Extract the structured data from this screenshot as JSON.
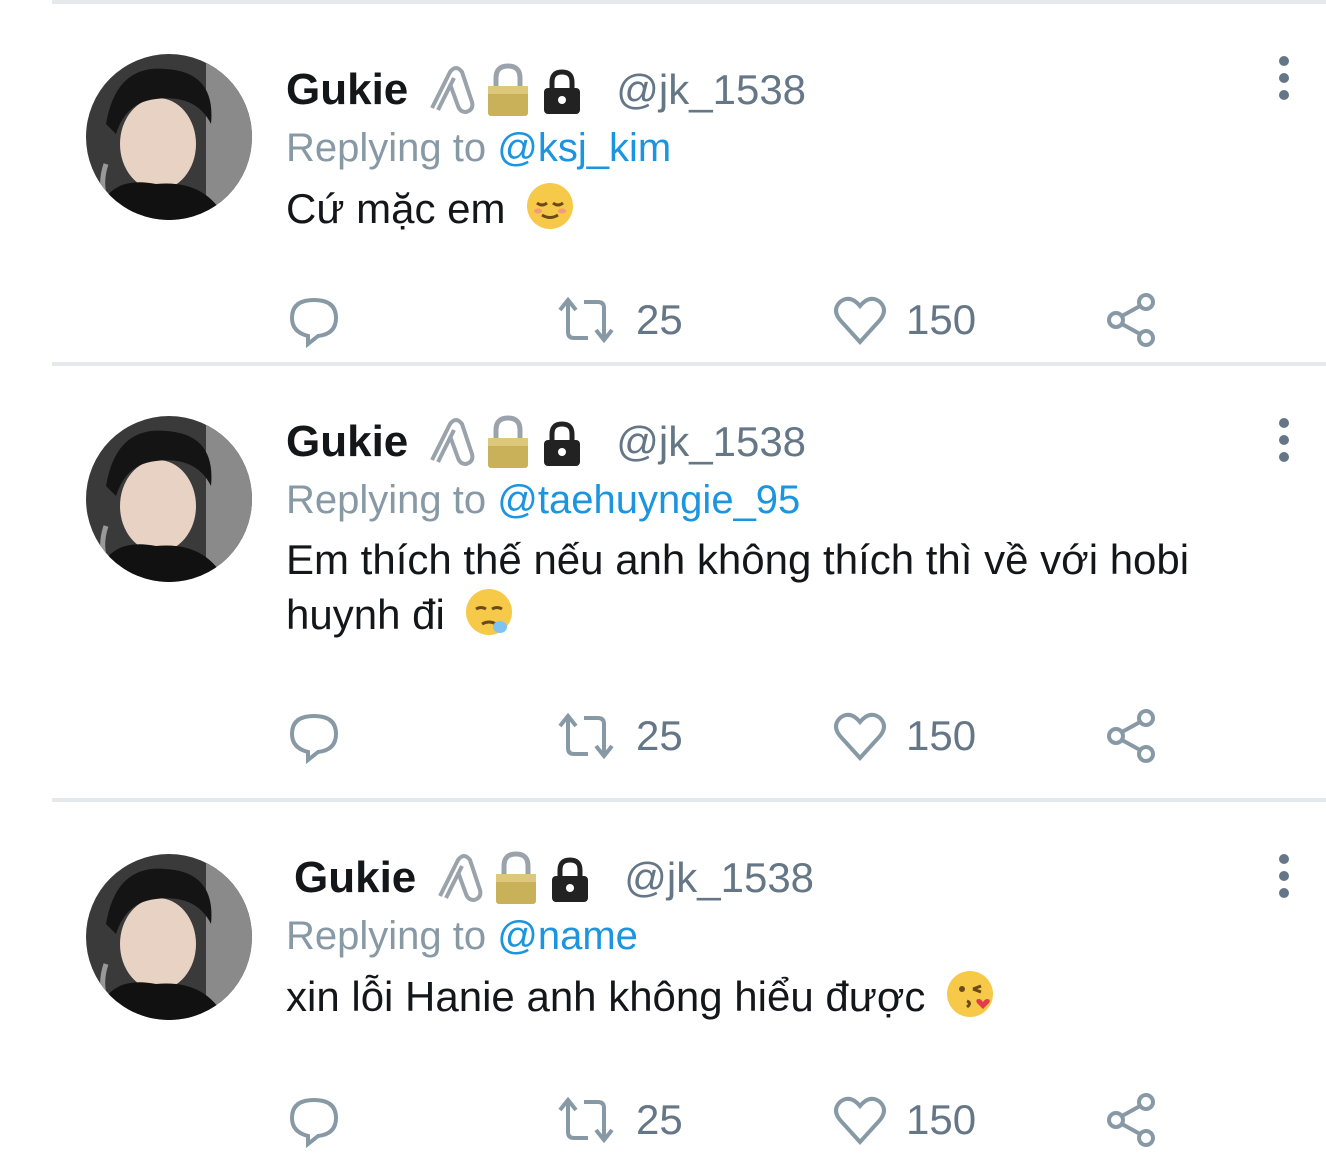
{
  "tweets": [
    {
      "name": "Gukie",
      "handle": "@jk_1538",
      "replying_prefix": "Replying to ",
      "replying_to": "@ksj_kim",
      "text": "Cứ mặc em",
      "emoji": "relieved-face",
      "retweets": "25",
      "likes": "150"
    },
    {
      "name": "Gukie",
      "handle": "@jk_1538",
      "replying_prefix": "Replying to ",
      "replying_to": "@taehuyngie_95",
      "text": "Em thích thế nếu anh không thích thì về với hobi huynh đi",
      "emoji": "sleepy-face",
      "retweets": "25",
      "likes": "150"
    },
    {
      "name": "Gukie",
      "handle": "@jk_1538",
      "replying_prefix": "Replying to ",
      "replying_to": "@name",
      "text": "xin lỗi Hanie anh không hiểu được",
      "emoji": "kissing-heart-face",
      "retweets": "25",
      "likes": "150"
    }
  ],
  "colors": {
    "name": "#14171a",
    "secondary": "#657786",
    "mention": "#1b95e0",
    "divider": "#e6e9ec",
    "icon": "#8899a6"
  },
  "badge_icons": [
    "paperclip-icon",
    "gold-lock-icon",
    "black-lock-icon"
  ]
}
